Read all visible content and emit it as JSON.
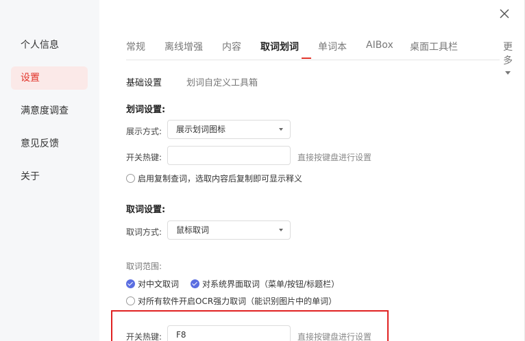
{
  "sidebar": {
    "items": [
      {
        "label": "个人信息",
        "active": false
      },
      {
        "label": "设置",
        "active": true
      },
      {
        "label": "满意度调查",
        "active": false
      },
      {
        "label": "意见反馈",
        "active": false
      },
      {
        "label": "关于",
        "active": false
      }
    ]
  },
  "tabs": [
    "常规",
    "离线增强",
    "内容",
    "取词划词",
    "单词本",
    "AIBox",
    "桌面工具栏"
  ],
  "active_tab": "取词划词",
  "more_label": "更多",
  "subtabs": [
    "基础设置",
    "划词自定义工具箱"
  ],
  "highlight_section": {
    "title": "划词设置:",
    "display_label": "展示方式:",
    "display_value": "展示划词图标",
    "hotkey_label": "开关热键:",
    "hotkey_value": "",
    "hotkey_hint": "直接按键盘进行设置",
    "copy_query_option": "启用复制查词，选取内容后复制即可显示释义"
  },
  "pick_section": {
    "title": "取词设置:",
    "method_label": "取词方式:",
    "method_value": "鼠标取词",
    "range_label": "取词范围:",
    "range_options": [
      {
        "label": "对中文取词",
        "checked": true
      },
      {
        "label": "对系统界面取词（菜单/按钮/标题栏）",
        "checked": true
      },
      {
        "label": "对所有软件开启OCR强力取词（能识别图片中的单词）",
        "checked": false
      }
    ],
    "hotkey_label": "开关热键:",
    "hotkey_value": "F8",
    "hotkey_hint": "直接按键盘进行设置"
  },
  "colors": {
    "accent": "#e2342a",
    "check": "#5b6ee1",
    "highlight_border": "#e02020"
  }
}
